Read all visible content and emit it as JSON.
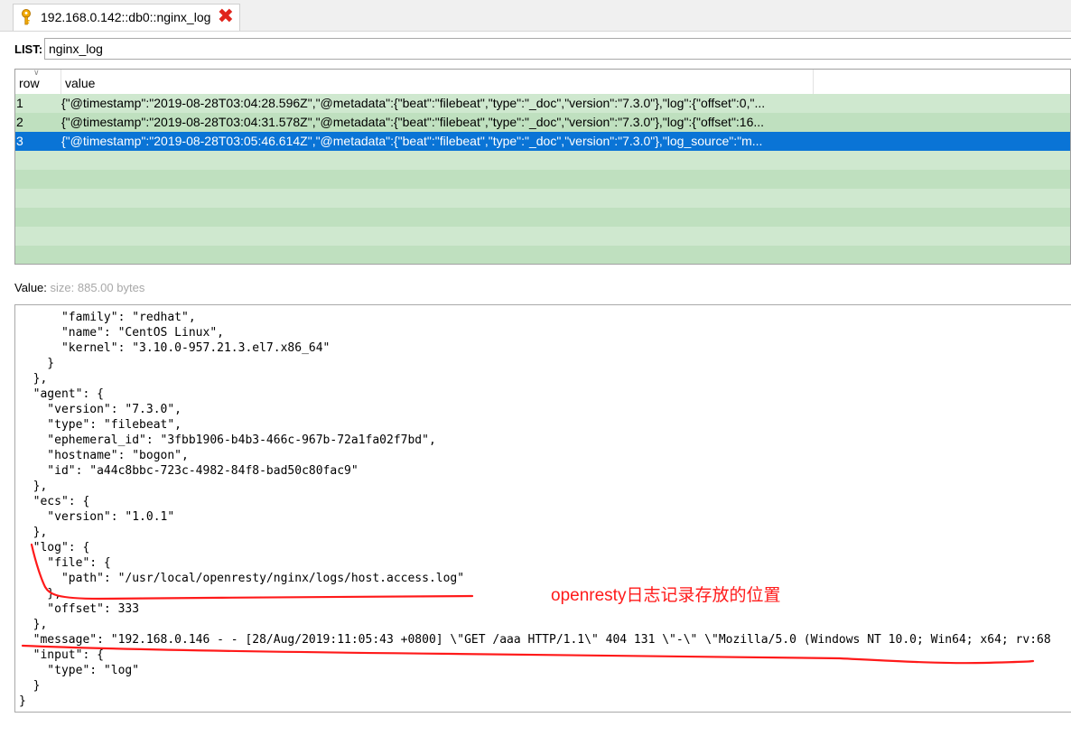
{
  "tab": {
    "title": "192.168.0.142::db0::nginx_log",
    "close_glyph": "✖",
    "icon": "key-icon"
  },
  "list": {
    "label": "LIST:",
    "value": "nginx_log"
  },
  "grid": {
    "columns": [
      "row",
      "value"
    ],
    "rows": [
      {
        "row": "1",
        "value": "{\"@timestamp\":\"2019-08-28T03:04:28.596Z\",\"@metadata\":{\"beat\":\"filebeat\",\"type\":\"_doc\",\"version\":\"7.3.0\"},\"log\":{\"offset\":0,\"..."
      },
      {
        "row": "2",
        "value": "{\"@timestamp\":\"2019-08-28T03:04:31.578Z\",\"@metadata\":{\"beat\":\"filebeat\",\"type\":\"_doc\",\"version\":\"7.3.0\"},\"log\":{\"offset\":16..."
      },
      {
        "row": "3",
        "value": "{\"@timestamp\":\"2019-08-28T03:05:46.614Z\",\"@metadata\":{\"beat\":\"filebeat\",\"type\":\"_doc\",\"version\":\"7.3.0\"},\"log_source\":\"m..."
      }
    ],
    "selected_row": "3",
    "colors": {
      "row_light": "#cfe8cf",
      "row_dark": "#bfe0bf",
      "selected": "#0a74d6"
    }
  },
  "value_panel": {
    "label": "Value:",
    "size": "size: 885.00 bytes"
  },
  "editor": {
    "lines": [
      "      \"family\": \"redhat\",",
      "      \"name\": \"CentOS Linux\",",
      "      \"kernel\": \"3.10.0-957.21.3.el7.x86_64\"",
      "    }",
      "  },",
      "  \"agent\": {",
      "    \"version\": \"7.3.0\",",
      "    \"type\": \"filebeat\",",
      "    \"ephemeral_id\": \"3fbb1906-b4b3-466c-967b-72a1fa02f7bd\",",
      "    \"hostname\": \"bogon\",",
      "    \"id\": \"a44c8bbc-723c-4982-84f8-bad50c80fac9\"",
      "  },",
      "  \"ecs\": {",
      "    \"version\": \"1.0.1\"",
      "  },",
      "  \"log\": {",
      "    \"file\": {",
      "      \"path\": \"/usr/local/openresty/nginx/logs/host.access.log\"",
      "    },",
      "    \"offset\": 333",
      "  },",
      "  \"message\": \"192.168.0.146 - - [28/Aug/2019:11:05:43 +0800] \\\"GET /aaa HTTP/1.1\\\" 404 131 \\\"-\\\" \\\"Mozilla/5.0 (Windows NT 10.0; Win64; x64; rv:68",
      "  \"input\": {",
      "    \"type\": \"log\"",
      "  }",
      "}"
    ]
  },
  "annotation": {
    "text": "openresty日志记录存放的位置",
    "color": "#ff1a1a"
  }
}
